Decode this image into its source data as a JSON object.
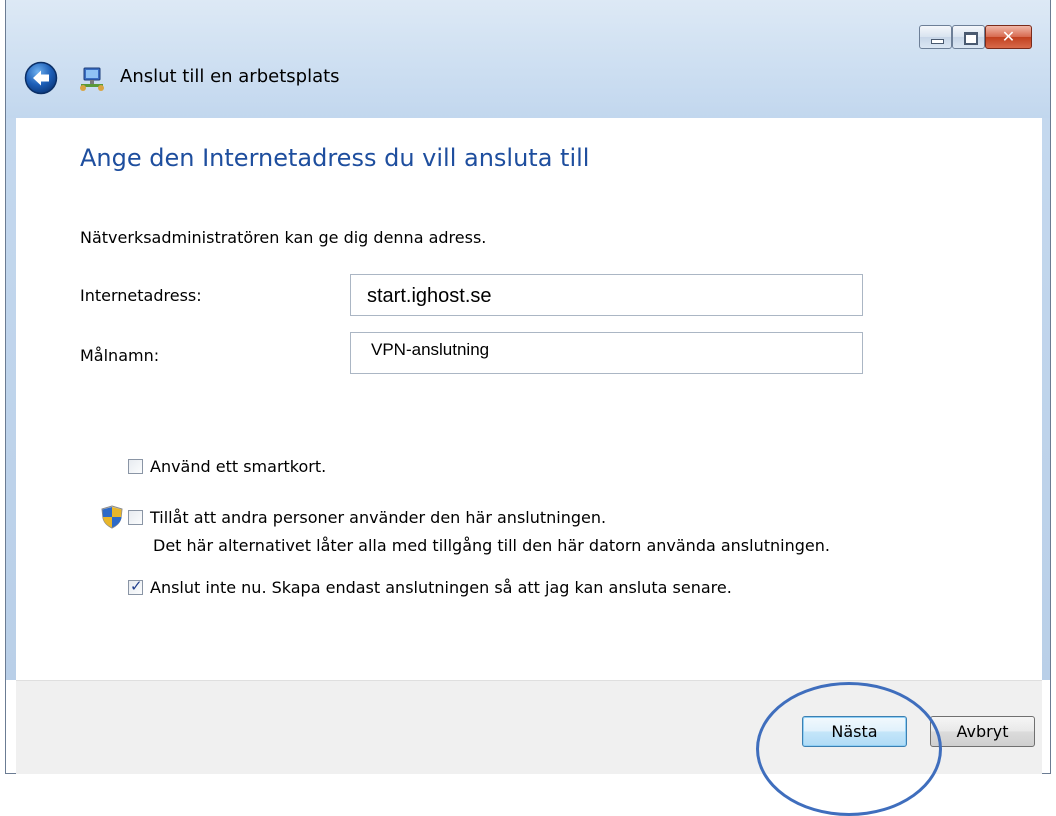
{
  "window": {
    "title": "Anslut till en arbetsplats",
    "close_glyph": "✕",
    "back_icon": "back-arrow-icon",
    "wizard_icon": "network-workplace-icon"
  },
  "main": {
    "heading": "Ange den Internetadress du vill ansluta till",
    "description": "Nätverksadministratören kan ge dig denna adress.",
    "internet_address_label": "Internetadress:",
    "internet_address_value": "start.ighost.se",
    "target_name_label": "Målnamn:",
    "target_name_value": "VPN-anslutning",
    "smartcard_label": "Använd ett smartkort.",
    "smartcard_checked": false,
    "allow_others_label": "Tillåt att andra personer använder den här anslutningen.",
    "allow_others_checked": false,
    "allow_others_note": "Det här alternativet låter alla med tillgång till den här datorn använda anslutningen.",
    "dont_connect_label": "Anslut inte nu. Skapa endast anslutningen så att jag kan ansluta senare.",
    "dont_connect_checked": true,
    "check_glyph": "✓"
  },
  "footer": {
    "next_label": "Nästa",
    "cancel_label": "Avbryt"
  },
  "colors": {
    "heading": "#1e4e9e",
    "annotation": "#3f6ebd"
  }
}
